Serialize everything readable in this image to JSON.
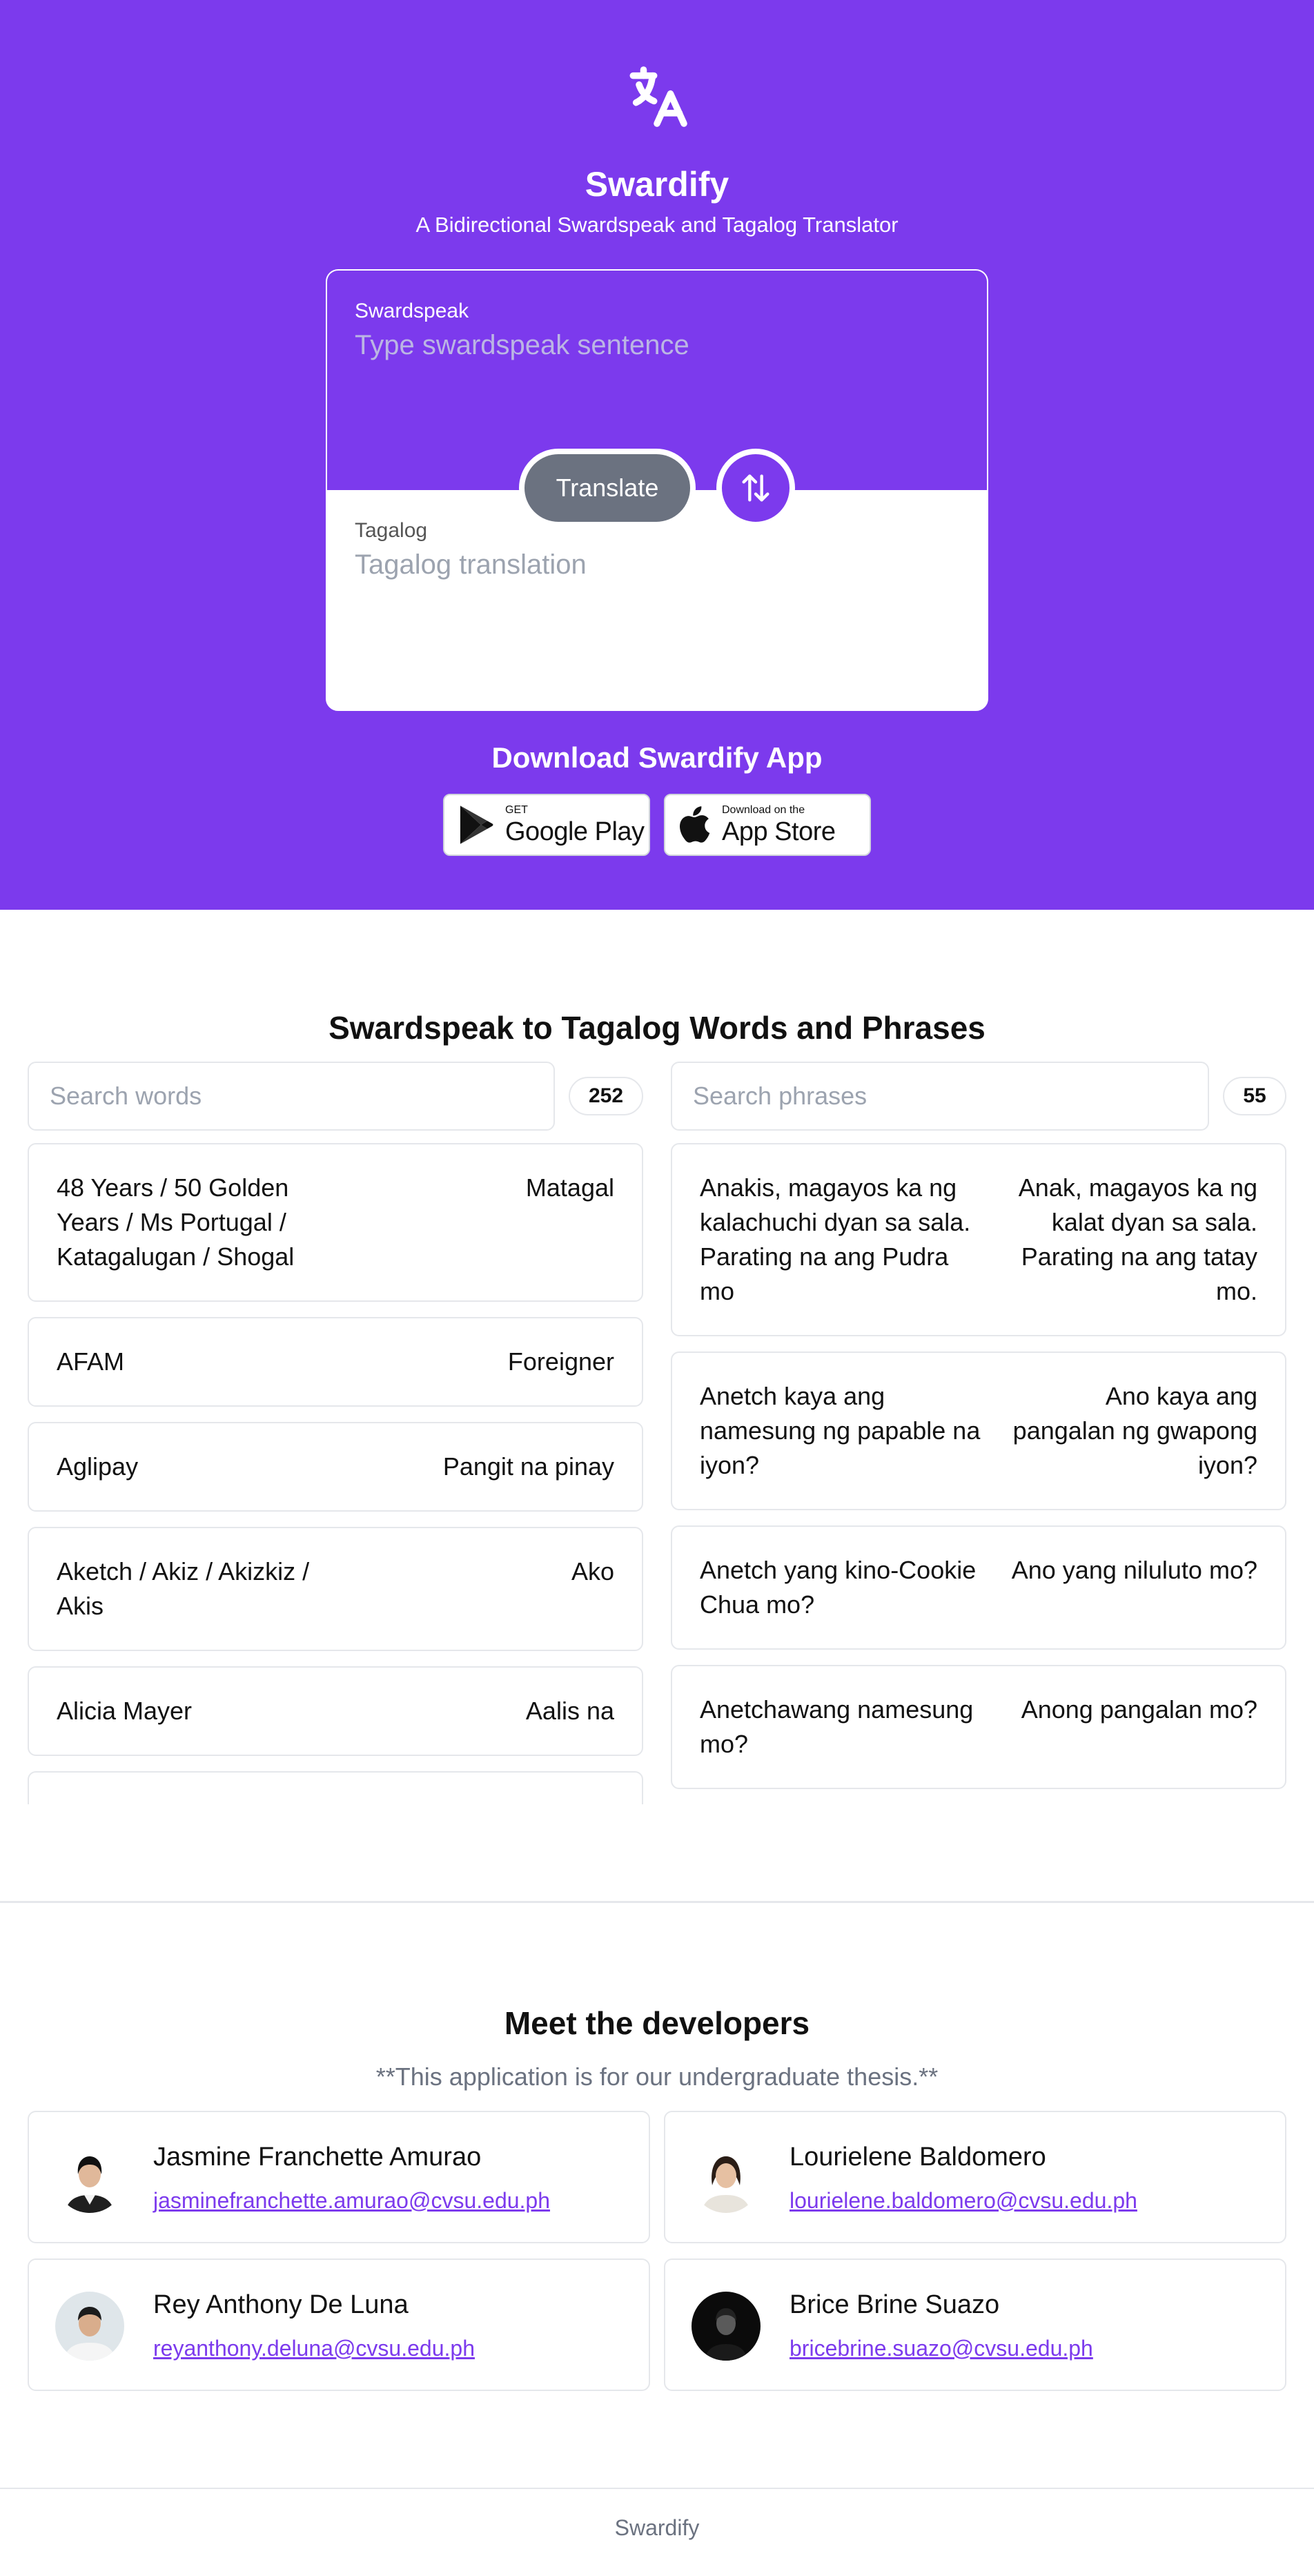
{
  "header": {
    "logo_icon": "translate-icon",
    "title": "Swardify",
    "subtitle": "A Bidirectional Swardspeak and Tagalog Translator"
  },
  "translator": {
    "source_label": "Swardspeak",
    "source_placeholder": "Type swardspeak sentence",
    "target_label": "Tagalog",
    "target_placeholder": "Tagalog translation",
    "translate_label": "Translate",
    "swap_icon": "swap-vertical-icon"
  },
  "download": {
    "title": "Download Swardify App",
    "google": {
      "small": "GET",
      "big": "Google Play"
    },
    "apple": {
      "small": "Download on the",
      "big": "App Store"
    }
  },
  "dictionary": {
    "title": "Swardspeak to Tagalog Words and Phrases",
    "words_placeholder": "Search words",
    "words_count": "252",
    "phrases_placeholder": "Search phrases",
    "phrases_count": "55",
    "words": [
      {
        "swardspeak": "48 Years / 50 Golden Years / Ms Portugal / Katagalugan / Shogal",
        "tagalog": "Matagal"
      },
      {
        "swardspeak": "AFAM",
        "tagalog": "Foreigner"
      },
      {
        "swardspeak": "Aglipay",
        "tagalog": "Pangit na pinay"
      },
      {
        "swardspeak": "Aketch / Akiz / Akizkiz / Akis",
        "tagalog": "Ako"
      },
      {
        "swardspeak": "Alicia Mayer",
        "tagalog": "Aalis na"
      }
    ],
    "phrases": [
      {
        "swardspeak": "Anakis, magayos ka ng kalachuchi dyan sa sala. Parating na ang Pudra mo",
        "tagalog": "Anak, magayos ka ng kalat dyan sa sala. Parating na ang tatay mo."
      },
      {
        "swardspeak": "Anetch kaya ang namesung ng papable na iyon?",
        "tagalog": "Ano kaya ang pangalan ng gwapong iyon?"
      },
      {
        "swardspeak": "Anetch yang kino-Cookie Chua mo?",
        "tagalog": "Ano yang niluluto mo?"
      },
      {
        "swardspeak": "Anetchawang namesung mo?",
        "tagalog": "Anong pangalan mo?"
      }
    ]
  },
  "developers": {
    "title": "Meet the developers",
    "note": "**This application is for our undergraduate thesis.**",
    "people": [
      {
        "name": "Jasmine Franchette Amurao",
        "email": "jasminefranchette.amurao@cvsu.edu.ph"
      },
      {
        "name": "Lourielene Baldomero",
        "email": "lourielene.baldomero@cvsu.edu.ph"
      },
      {
        "name": "Rey Anthony De Luna",
        "email": "reyanthony.deluna@cvsu.edu.ph"
      },
      {
        "name": "Brice Brine Suazo",
        "email": "bricebrine.suazo@cvsu.edu.ph"
      }
    ]
  },
  "footer": {
    "text": "Swardify"
  },
  "colors": {
    "brand": "#7c3aed",
    "translate_button": "#6b7280",
    "link": "#7c3aed"
  }
}
